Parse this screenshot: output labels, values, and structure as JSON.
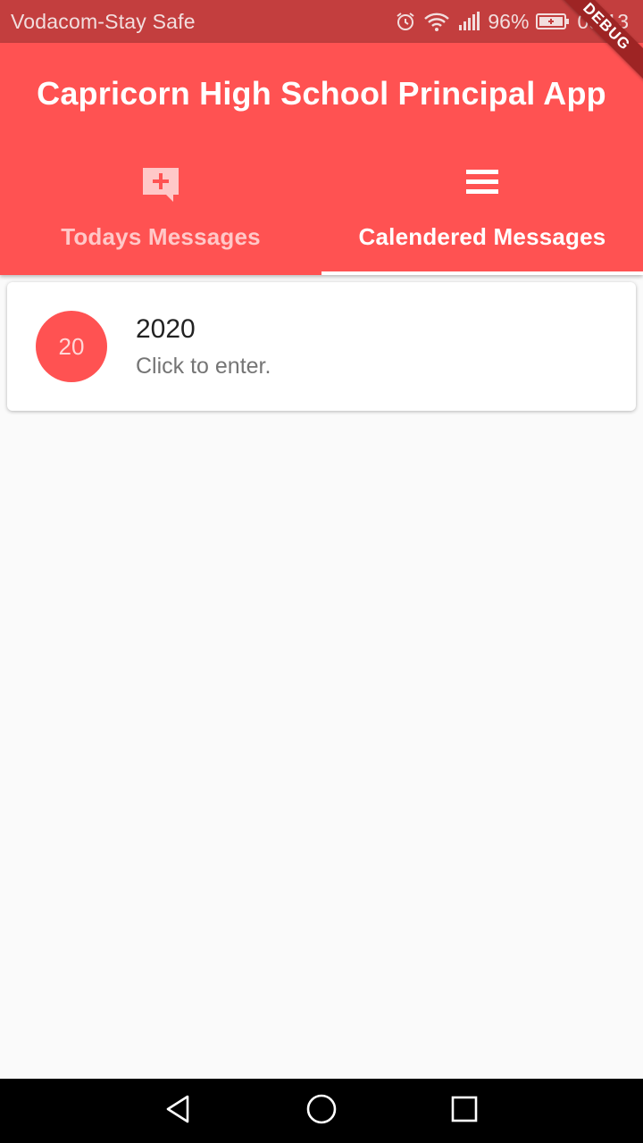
{
  "status_bar": {
    "carrier": "Vodacom-Stay Safe",
    "battery_percent": "96%",
    "time": "09:13",
    "icons": [
      "alarm-icon",
      "wifi-icon",
      "signal-icon",
      "battery-icon"
    ]
  },
  "debug_banner": "DEBUG",
  "app_bar": {
    "title": "Capricorn High School Principal App",
    "color": "#ff5252"
  },
  "tabs": [
    {
      "label": "Todays Messages",
      "icon": "add-comment-icon",
      "selected": false
    },
    {
      "label": "Calendered Messages",
      "icon": "menu-icon",
      "selected": true
    }
  ],
  "list": [
    {
      "avatar_text": "20",
      "title": "2020",
      "subtitle": "Click to enter."
    }
  ],
  "nav_bar": {
    "icons": [
      "back-icon",
      "home-icon",
      "recents-icon"
    ]
  }
}
